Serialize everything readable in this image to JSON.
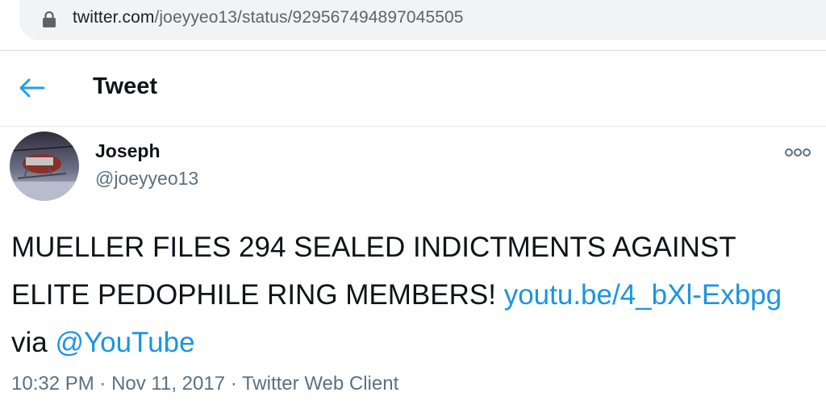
{
  "browser": {
    "url_host": "twitter.com",
    "url_path": "/joeyyeo13/status/929567494897045505"
  },
  "header": {
    "title": "Tweet"
  },
  "tweet": {
    "author_name": "Joseph",
    "author_handle": "@joeyyeo13",
    "text_main": "MUELLER FILES 294 SEALED INDICTMENTS AGAINST ELITE PEDOPHILE RING MEMBERS! ",
    "link_text": "youtu.be/4_bXl-Exbpg",
    "text_via": " via ",
    "mention": "@YouTube",
    "time": "10:32 PM",
    "sep1": " · ",
    "date": "Nov 11, 2017",
    "sep2": " · ",
    "client": "Twitter Web Client"
  },
  "icons": {
    "lock": "lock-icon",
    "back": "back-arrow-icon",
    "more": "more-options-icon"
  },
  "colors": {
    "link": "#1b95e0",
    "accent": "#1da1f2",
    "secondary_text": "#5b7083"
  }
}
